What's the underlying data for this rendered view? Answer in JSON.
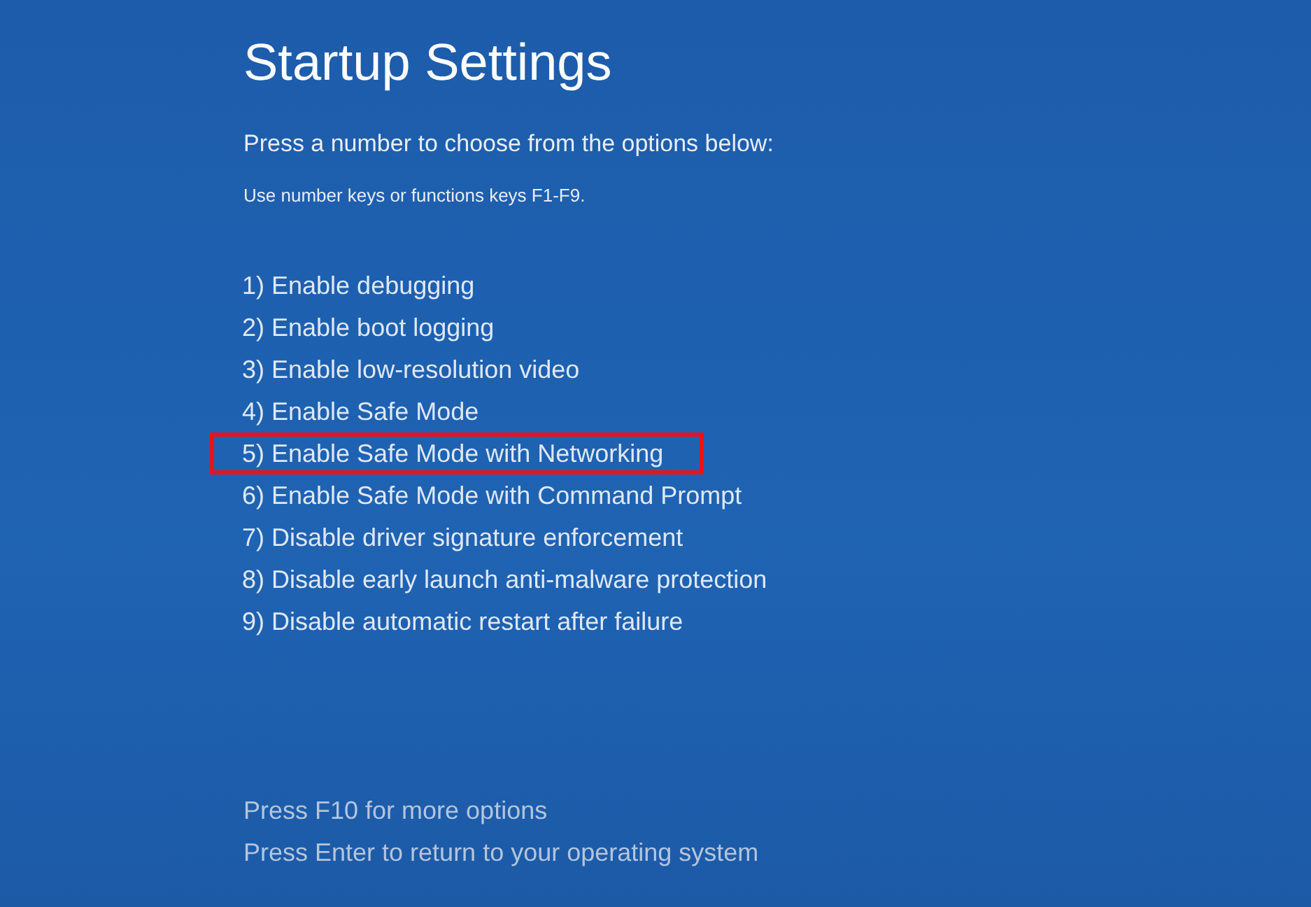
{
  "title": "Startup Settings",
  "prompt": "Press a number to choose from the options below:",
  "hint": "Use number keys or functions keys F1-F9.",
  "options": [
    {
      "label": "1) Enable debugging",
      "highlighted": false
    },
    {
      "label": "2) Enable boot logging",
      "highlighted": false
    },
    {
      "label": "3) Enable low-resolution video",
      "highlighted": false
    },
    {
      "label": "4) Enable Safe Mode",
      "highlighted": false
    },
    {
      "label": "5) Enable Safe Mode with Networking",
      "highlighted": true
    },
    {
      "label": "6) Enable Safe Mode with Command Prompt",
      "highlighted": false
    },
    {
      "label": "7) Disable driver signature enforcement",
      "highlighted": false
    },
    {
      "label": "8) Disable early launch anti-malware protection",
      "highlighted": false
    },
    {
      "label": "9) Disable automatic restart after failure",
      "highlighted": false
    }
  ],
  "footer": [
    "Press F10 for more options",
    "Press Enter to return to your operating system"
  ]
}
